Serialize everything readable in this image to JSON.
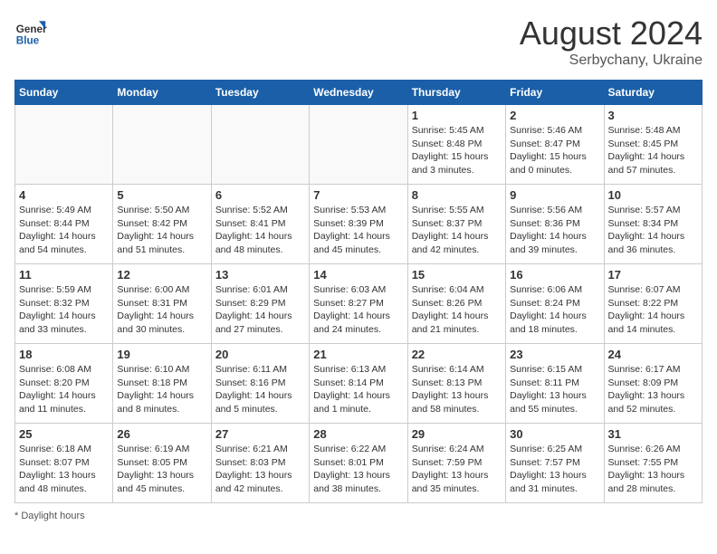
{
  "header": {
    "logo_line1": "General",
    "logo_line2": "Blue",
    "month_title": "August 2024",
    "subtitle": "Serbychany, Ukraine"
  },
  "days_of_week": [
    "Sunday",
    "Monday",
    "Tuesday",
    "Wednesday",
    "Thursday",
    "Friday",
    "Saturday"
  ],
  "footer": {
    "note": "Daylight hours"
  },
  "weeks": [
    [
      {
        "day": "",
        "info": ""
      },
      {
        "day": "",
        "info": ""
      },
      {
        "day": "",
        "info": ""
      },
      {
        "day": "",
        "info": ""
      },
      {
        "day": "1",
        "info": "Sunrise: 5:45 AM\nSunset: 8:48 PM\nDaylight: 15 hours\nand 3 minutes."
      },
      {
        "day": "2",
        "info": "Sunrise: 5:46 AM\nSunset: 8:47 PM\nDaylight: 15 hours\nand 0 minutes."
      },
      {
        "day": "3",
        "info": "Sunrise: 5:48 AM\nSunset: 8:45 PM\nDaylight: 14 hours\nand 57 minutes."
      }
    ],
    [
      {
        "day": "4",
        "info": "Sunrise: 5:49 AM\nSunset: 8:44 PM\nDaylight: 14 hours\nand 54 minutes."
      },
      {
        "day": "5",
        "info": "Sunrise: 5:50 AM\nSunset: 8:42 PM\nDaylight: 14 hours\nand 51 minutes."
      },
      {
        "day": "6",
        "info": "Sunrise: 5:52 AM\nSunset: 8:41 PM\nDaylight: 14 hours\nand 48 minutes."
      },
      {
        "day": "7",
        "info": "Sunrise: 5:53 AM\nSunset: 8:39 PM\nDaylight: 14 hours\nand 45 minutes."
      },
      {
        "day": "8",
        "info": "Sunrise: 5:55 AM\nSunset: 8:37 PM\nDaylight: 14 hours\nand 42 minutes."
      },
      {
        "day": "9",
        "info": "Sunrise: 5:56 AM\nSunset: 8:36 PM\nDaylight: 14 hours\nand 39 minutes."
      },
      {
        "day": "10",
        "info": "Sunrise: 5:57 AM\nSunset: 8:34 PM\nDaylight: 14 hours\nand 36 minutes."
      }
    ],
    [
      {
        "day": "11",
        "info": "Sunrise: 5:59 AM\nSunset: 8:32 PM\nDaylight: 14 hours\nand 33 minutes."
      },
      {
        "day": "12",
        "info": "Sunrise: 6:00 AM\nSunset: 8:31 PM\nDaylight: 14 hours\nand 30 minutes."
      },
      {
        "day": "13",
        "info": "Sunrise: 6:01 AM\nSunset: 8:29 PM\nDaylight: 14 hours\nand 27 minutes."
      },
      {
        "day": "14",
        "info": "Sunrise: 6:03 AM\nSunset: 8:27 PM\nDaylight: 14 hours\nand 24 minutes."
      },
      {
        "day": "15",
        "info": "Sunrise: 6:04 AM\nSunset: 8:26 PM\nDaylight: 14 hours\nand 21 minutes."
      },
      {
        "day": "16",
        "info": "Sunrise: 6:06 AM\nSunset: 8:24 PM\nDaylight: 14 hours\nand 18 minutes."
      },
      {
        "day": "17",
        "info": "Sunrise: 6:07 AM\nSunset: 8:22 PM\nDaylight: 14 hours\nand 14 minutes."
      }
    ],
    [
      {
        "day": "18",
        "info": "Sunrise: 6:08 AM\nSunset: 8:20 PM\nDaylight: 14 hours\nand 11 minutes."
      },
      {
        "day": "19",
        "info": "Sunrise: 6:10 AM\nSunset: 8:18 PM\nDaylight: 14 hours\nand 8 minutes."
      },
      {
        "day": "20",
        "info": "Sunrise: 6:11 AM\nSunset: 8:16 PM\nDaylight: 14 hours\nand 5 minutes."
      },
      {
        "day": "21",
        "info": "Sunrise: 6:13 AM\nSunset: 8:14 PM\nDaylight: 14 hours\nand 1 minute."
      },
      {
        "day": "22",
        "info": "Sunrise: 6:14 AM\nSunset: 8:13 PM\nDaylight: 13 hours\nand 58 minutes."
      },
      {
        "day": "23",
        "info": "Sunrise: 6:15 AM\nSunset: 8:11 PM\nDaylight: 13 hours\nand 55 minutes."
      },
      {
        "day": "24",
        "info": "Sunrise: 6:17 AM\nSunset: 8:09 PM\nDaylight: 13 hours\nand 52 minutes."
      }
    ],
    [
      {
        "day": "25",
        "info": "Sunrise: 6:18 AM\nSunset: 8:07 PM\nDaylight: 13 hours\nand 48 minutes."
      },
      {
        "day": "26",
        "info": "Sunrise: 6:19 AM\nSunset: 8:05 PM\nDaylight: 13 hours\nand 45 minutes."
      },
      {
        "day": "27",
        "info": "Sunrise: 6:21 AM\nSunset: 8:03 PM\nDaylight: 13 hours\nand 42 minutes."
      },
      {
        "day": "28",
        "info": "Sunrise: 6:22 AM\nSunset: 8:01 PM\nDaylight: 13 hours\nand 38 minutes."
      },
      {
        "day": "29",
        "info": "Sunrise: 6:24 AM\nSunset: 7:59 PM\nDaylight: 13 hours\nand 35 minutes."
      },
      {
        "day": "30",
        "info": "Sunrise: 6:25 AM\nSunset: 7:57 PM\nDaylight: 13 hours\nand 31 minutes."
      },
      {
        "day": "31",
        "info": "Sunrise: 6:26 AM\nSunset: 7:55 PM\nDaylight: 13 hours\nand 28 minutes."
      }
    ]
  ]
}
